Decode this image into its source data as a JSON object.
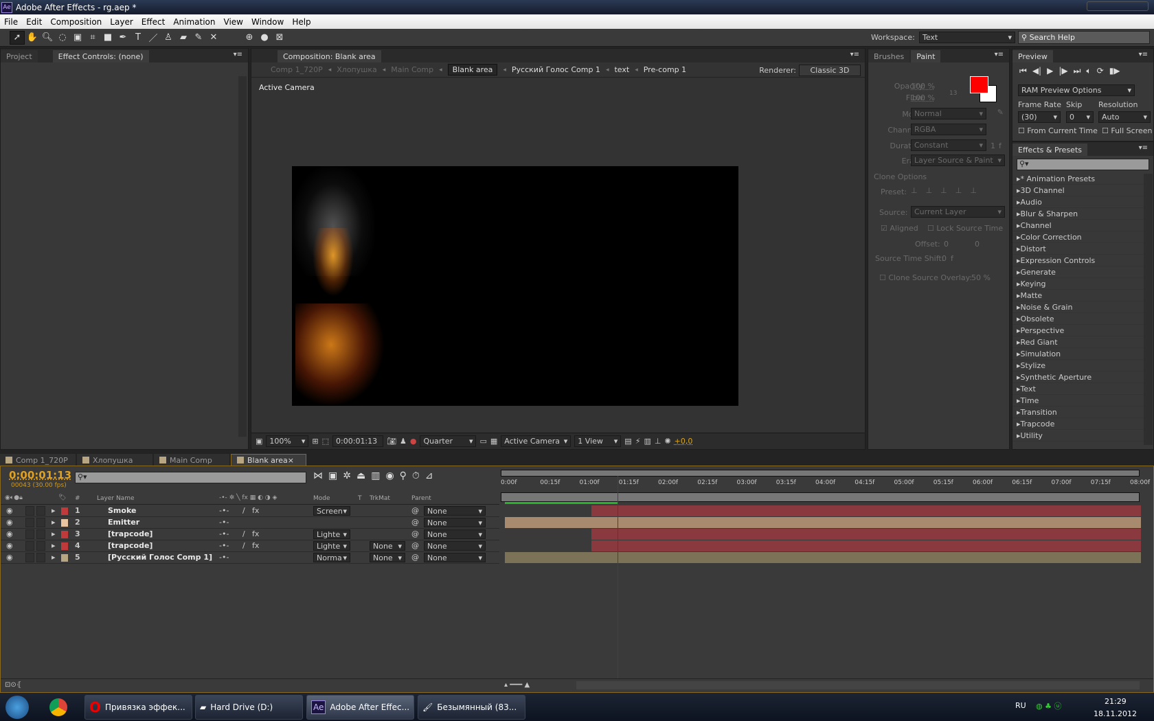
{
  "window": {
    "title": "Adobe After Effects - rg.aep *",
    "app_icon": "Ae"
  },
  "menu": [
    "File",
    "Edit",
    "Composition",
    "Layer",
    "Effect",
    "Animation",
    "View",
    "Window",
    "Help"
  ],
  "workspace": {
    "label": "Workspace:",
    "value": "Text",
    "search_placeholder": "Search Help"
  },
  "left_panel": {
    "tab_project": "Project",
    "tab_effect_controls": "Effect Controls: (none)"
  },
  "comp_panel": {
    "tab": "Composition: Blank area",
    "breadcrumbs": [
      "Comp 1_720P",
      "Хлопушка",
      "Main Comp",
      "Blank area",
      "Русский Голос  Comp 1",
      "text",
      "Pre-comp 1"
    ],
    "active_breadcrumb": "Blank area",
    "renderer_label": "Renderer:",
    "renderer": "Classic 3D",
    "view_label": "Active Camera",
    "footer": {
      "zoom": "100%",
      "timecode": "0:00:01:13",
      "resolution": "Quarter",
      "camera": "Active Camera",
      "views": "1 View",
      "exposure": "+0,0"
    }
  },
  "paint_panel": {
    "tab_brushes": "Brushes",
    "tab_paint": "Paint",
    "opacity_label": "Opacity:",
    "opacity": "100 %",
    "flow_label": "Flow:",
    "flow": "100 %",
    "brush_size": "13",
    "fg_color": "#ff0000",
    "bg_color": "#ffffff",
    "mode_label": "Mode:",
    "mode": "Normal",
    "channels_label": "Channels:",
    "channels": "RGBA",
    "duration_label": "Duration:",
    "duration": "Constant",
    "duration_frames": "1",
    "duration_unit": "f",
    "erase_label": "Erase:",
    "erase": "Layer Source & Paint",
    "clone_options": "Clone Options",
    "preset_label": "Preset:",
    "source_label": "Source:",
    "source": "Current Layer",
    "aligned": "Aligned",
    "lock_source_time": "Lock Source Time",
    "offset_label": "Offset:",
    "offset_x": "0",
    "offset_y": "0",
    "sts_label": "Source Time Shift:",
    "sts": "0",
    "sts_unit": "f",
    "overlay_label": "Clone Source Overlay:",
    "overlay": "50 %"
  },
  "preview_panel": {
    "tab": "Preview",
    "ram_options": "RAM Preview Options",
    "frame_rate_label": "Frame Rate",
    "frame_rate": "(30)",
    "skip_label": "Skip",
    "skip": "0",
    "resolution_label": "Resolution",
    "resolution": "Auto",
    "from_current": "From Current Time",
    "full_screen": "Full Screen"
  },
  "effects_panel": {
    "tab": "Effects & Presets",
    "items": [
      "* Animation Presets",
      "3D Channel",
      "Audio",
      "Blur & Sharpen",
      "Channel",
      "Color Correction",
      "Distort",
      "Expression Controls",
      "Generate",
      "Keying",
      "Matte",
      "Noise & Grain",
      "Obsolete",
      "Perspective",
      "Red Giant",
      "Simulation",
      "Stylize",
      "Synthetic Aperture",
      "Text",
      "Time",
      "Transition",
      "Trapcode",
      "Utility"
    ]
  },
  "timeline": {
    "tabs": [
      "Comp 1_720P",
      "Хлопушка",
      "Main Comp",
      "Blank area"
    ],
    "active_tab": "Blank area",
    "timecode": "0:00:01:13",
    "frame_info": "00043 (30.00 fps)",
    "columns": {
      "num": "#",
      "name": "Layer Name",
      "mode": "Mode",
      "t": "T",
      "trkmat": "TrkMat",
      "parent": "Parent"
    },
    "ruler": [
      "0:00f",
      "00:15f",
      "01:00f",
      "01:15f",
      "02:00f",
      "02:15f",
      "03:00f",
      "03:15f",
      "04:00f",
      "04:15f",
      "05:00f",
      "05:15f",
      "06:00f",
      "06:15f",
      "07:00f",
      "07:15f",
      "08:00f"
    ],
    "current_time_seconds": 1.433,
    "layers": [
      {
        "num": "1",
        "name": "Smoke",
        "label_color": "#c0393b",
        "mode": "Screen",
        "trkmat": "",
        "parent": "None",
        "in": 1.1,
        "bar_color": "#8a3a3f",
        "fx": true
      },
      {
        "num": "2",
        "name": "Emitter",
        "label_color": "#e8c4a0",
        "mode": "",
        "trkmat": "",
        "parent": "None",
        "in": 0,
        "bar_color": "#a88b6e",
        "fx": false
      },
      {
        "num": "3",
        "name": "[trapcode]",
        "label_color": "#c0393b",
        "mode": "Lighte",
        "trkmat": "",
        "parent": "None",
        "in": 1.1,
        "bar_color": "#8a3a3f",
        "fx": true
      },
      {
        "num": "4",
        "name": "[trapcode]",
        "label_color": "#c0393b",
        "mode": "Lighte",
        "trkmat": "None",
        "parent": "None",
        "in": 1.1,
        "bar_color": "#8a3a3f",
        "fx": true
      },
      {
        "num": "5",
        "name": "[Русский Голос  Comp 1]",
        "label_color": "#b8a582",
        "mode": "Norma",
        "trkmat": "None",
        "parent": "None",
        "in": 0,
        "bar_color": "#7c7258",
        "fx": false
      }
    ]
  },
  "taskbar": {
    "items": [
      "Привязка эффек...",
      "Hard Drive (D:)",
      "Adobe After Effec...",
      "Безымянный (83..."
    ],
    "lang": "RU",
    "time": "21:29",
    "date": "18.11.2012"
  }
}
